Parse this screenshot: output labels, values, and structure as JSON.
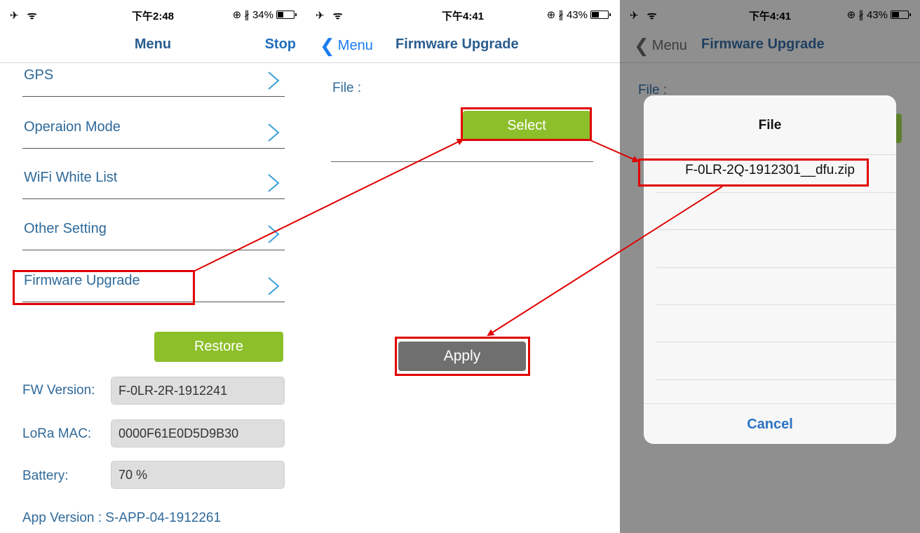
{
  "panel1": {
    "status": {
      "left": "✈ ᯤ",
      "time": "下午2:48",
      "right": "⊕ ∦ 34%",
      "battery_level": 0.34
    },
    "nav": {
      "title": "Menu",
      "stop": "Stop"
    },
    "menu_items": [
      "GPS",
      "Operaion Mode",
      "WiFi White List",
      "Other Setting",
      "Firmware Upgrade"
    ],
    "restore": "Restore",
    "fw_label": "FW Version:",
    "fw_value": "F-0LR-2R-1912241",
    "mac_label": "LoRa MAC:",
    "mac_value": "0000F61E0D5D9B30",
    "battery_label": "Battery:",
    "battery_value": "70 %",
    "app_version": "App Version :  S-APP-04-1912261"
  },
  "panel2": {
    "status": {
      "left": "✈ ᯤ",
      "time": "下午4:41",
      "right": "⊕ ∦ 43%",
      "battery_level": 0.43
    },
    "nav": {
      "back": "Menu",
      "title": "Firmware Upgrade"
    },
    "file_label": "File :",
    "select": "Select",
    "apply": "Apply"
  },
  "panel3": {
    "status": {
      "left": "✈ ᯤ",
      "time": "下午4:41",
      "right": "⊕ ∦ 43%",
      "battery_level": 0.43
    },
    "nav": {
      "back": "Menu",
      "title": "Firmware Upgrade"
    },
    "file_label": "File :",
    "dialog_title": "File",
    "file_item": "F-0LR-2Q-1912301__dfu.zip",
    "cancel": "Cancel"
  },
  "colors": {
    "accent_green": "#8cbf2a",
    "link_blue": "#1a7cf0",
    "highlight_red": "#e00000"
  }
}
